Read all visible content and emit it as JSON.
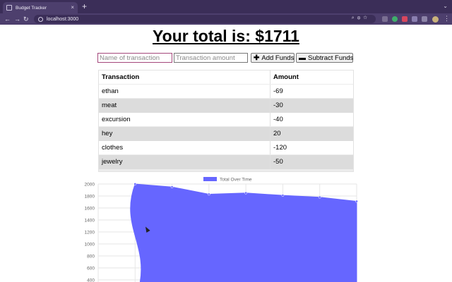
{
  "browser": {
    "tab_title": "Budget Tracker",
    "tab_close": "×",
    "new_tab": "+",
    "url": "localhost:3000"
  },
  "page": {
    "heading": "Your total is: $1711"
  },
  "form": {
    "name_placeholder": "Name of transaction",
    "amount_placeholder": "Transaction amount",
    "add_label": "Add Funds",
    "subtract_label": "Subtract Funds"
  },
  "table": {
    "headers": [
      "Transaction",
      "Amount"
    ],
    "rows": [
      {
        "name": "ethan",
        "amount": "-69"
      },
      {
        "name": "meat",
        "amount": "-30"
      },
      {
        "name": "excursion",
        "amount": "-40"
      },
      {
        "name": "hey",
        "amount": "20"
      },
      {
        "name": "clothes",
        "amount": "-120"
      },
      {
        "name": "jewelry",
        "amount": "-50"
      }
    ]
  },
  "chart_data": {
    "type": "area",
    "legend": [
      "Total Over Time"
    ],
    "legend_position": "top",
    "series": [
      {
        "name": "Total Over Time",
        "color": "#6666ff",
        "values": [
          null,
          2000,
          1950,
          1830,
          1850,
          1810,
          1780,
          1711
        ]
      }
    ],
    "ylim": [
      0,
      2000
    ],
    "yticks": [
      2000,
      1800,
      1600,
      1400,
      1200,
      1000,
      800,
      600,
      400
    ],
    "grid": true
  }
}
